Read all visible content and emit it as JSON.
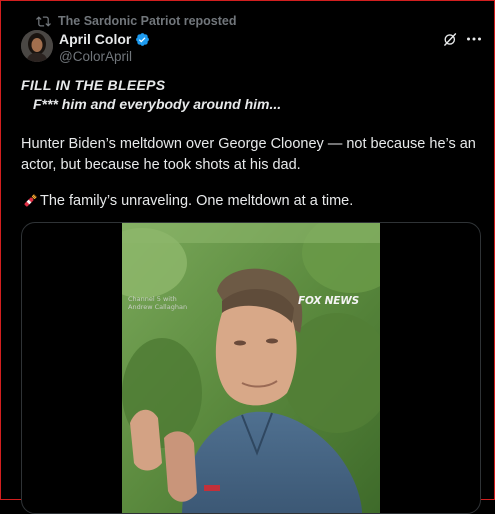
{
  "repost": {
    "text": "The Sardonic Patriot reposted",
    "icon": "repost-icon"
  },
  "author": {
    "display_name": "April Color",
    "handle": "@ColorApril",
    "verified": true,
    "verified_color": "#1d9bf0"
  },
  "actions": {
    "grok_icon": "grok-icon",
    "more_icon": "more-icon"
  },
  "post": {
    "bleep_title": "FILL IN THE BLEEPS",
    "bleep_line": "F*** him and everybody around him...",
    "paragraph1": "Hunter Biden’s meltdown over George Clooney — not because he’s an actor, but because he took shots at his dad.",
    "paragraph2": "The family’s unraveling. One meltdown at a time.",
    "paragraph2_icon": "firecracker-icon"
  },
  "media": {
    "watermark_line1": "Channel 5 with",
    "watermark_line2": "Andrew Callaghan",
    "network_logo": "FOX NEWS"
  },
  "colors": {
    "background": "#000000",
    "text": "#e7e9ea",
    "secondary_text": "#71767b",
    "border": "#2f3336"
  }
}
